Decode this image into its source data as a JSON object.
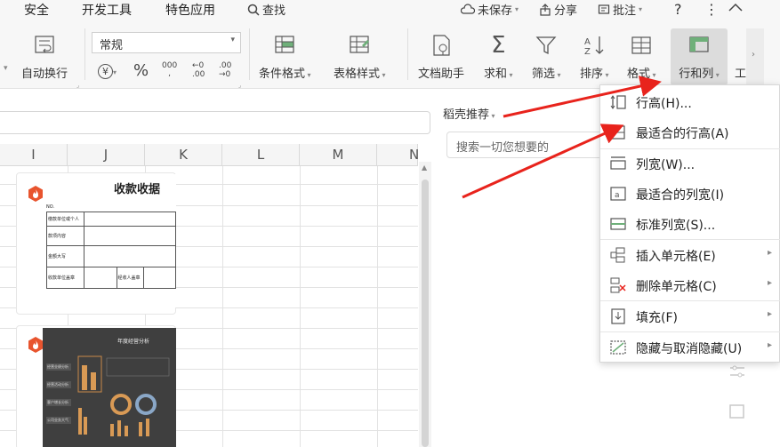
{
  "menubar": {
    "tabs": [
      "安全",
      "开发工具",
      "特色应用"
    ],
    "search_label": "查找",
    "save_status": "未保存",
    "share_label": "分享",
    "comment_label": "批注",
    "help_label": "?",
    "more_label": "⋮"
  },
  "ribbon": {
    "wrap_text": "自动换行",
    "number_format": "常规",
    "currency_symbol": "¥",
    "percent_symbol": "%",
    "thousands_symbol": "000",
    "dec_increase": "←0 .00",
    "dec_decrease": ".00 →0",
    "conditional_format": "条件格式",
    "table_style": "表格样式",
    "doc_assistant": "文档助手",
    "sum": "求和",
    "filter": "筛选",
    "sort": "排序",
    "format": "格式",
    "row_col": "行和列",
    "work": "工"
  },
  "grid": {
    "columns": [
      "I",
      "J",
      "K",
      "L",
      "M",
      "N"
    ]
  },
  "panel": {
    "title": "稻壳推荐",
    "search_placeholder": "搜索一切您想要的",
    "receipt_title": "收款收据",
    "receipt_rows": [
      "缴款单位或个人",
      "款项内容",
      "金额大写",
      "收款单位盖章",
      "经收人盖章"
    ],
    "dash_title": "年度经营分析",
    "dash_tags": [
      "经营业绩分析",
      "经营活动分析",
      "客户增长分析",
      "公司业务大气"
    ]
  },
  "menu": {
    "items": [
      {
        "label": "行高(H)...",
        "icon": "row-height-icon",
        "submenu": false
      },
      {
        "label": "最适合的行高(A)",
        "icon": "autofit-row-height-icon",
        "submenu": false
      },
      {
        "label": "列宽(W)...",
        "icon": "column-width-icon",
        "submenu": false
      },
      {
        "label": "最适合的列宽(I)",
        "icon": "autofit-column-width-icon",
        "submenu": false
      },
      {
        "label": "标准列宽(S)...",
        "icon": "standard-column-width-icon",
        "submenu": false
      },
      {
        "label": "插入单元格(E)",
        "icon": "insert-cells-icon",
        "submenu": true
      },
      {
        "label": "删除单元格(C)",
        "icon": "delete-cells-icon",
        "submenu": true
      },
      {
        "label": "填充(F)",
        "icon": "fill-icon",
        "submenu": true
      },
      {
        "label": "隐藏与取消隐藏(U)",
        "icon": "hide-unhide-icon",
        "submenu": true
      }
    ],
    "arrow_glyph": "▸"
  },
  "colors": {
    "accent": "#e8542e",
    "annotation_arrow": "#e8231c",
    "active_button_bg": "#dcdcdc"
  }
}
